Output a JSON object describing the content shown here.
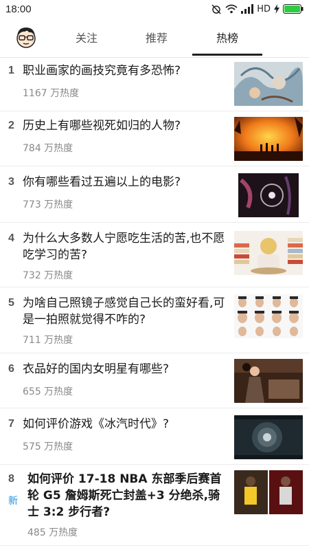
{
  "status": {
    "time": "18:00",
    "network": "HD"
  },
  "tabs": [
    {
      "label": "关注"
    },
    {
      "label": "推荐"
    },
    {
      "label": "热榜"
    }
  ],
  "items": [
    {
      "rank": "1",
      "title": "职业画家的画技究竟有多恐怖?",
      "heat": "1167 万热度"
    },
    {
      "rank": "2",
      "title": "历史上有哪些视死如归的人物?",
      "heat": "784 万热度"
    },
    {
      "rank": "3",
      "title": "你有哪些看过五遍以上的电影?",
      "heat": "773 万热度"
    },
    {
      "rank": "4",
      "title": "为什么大多数人宁愿吃生活的苦,也不愿吃学习的苦?",
      "heat": "732 万热度"
    },
    {
      "rank": "5",
      "title": "为啥自己照镜子感觉自己长的蛮好看,可是一拍照就觉得不咋的?",
      "heat": "711 万热度"
    },
    {
      "rank": "6",
      "title": "衣品好的国内女明星有哪些?",
      "heat": "655 万热度"
    },
    {
      "rank": "7",
      "title": "如何评价游戏《冰汽时代》?",
      "heat": "575 万热度"
    },
    {
      "rank": "8",
      "title": "如何评价 17-18 NBA 东部季后赛首轮 G5 詹姆斯死亡封盖+3 分绝杀,骑士 3:2 步行者?",
      "heat": "485 万热度",
      "badge": "新"
    }
  ]
}
